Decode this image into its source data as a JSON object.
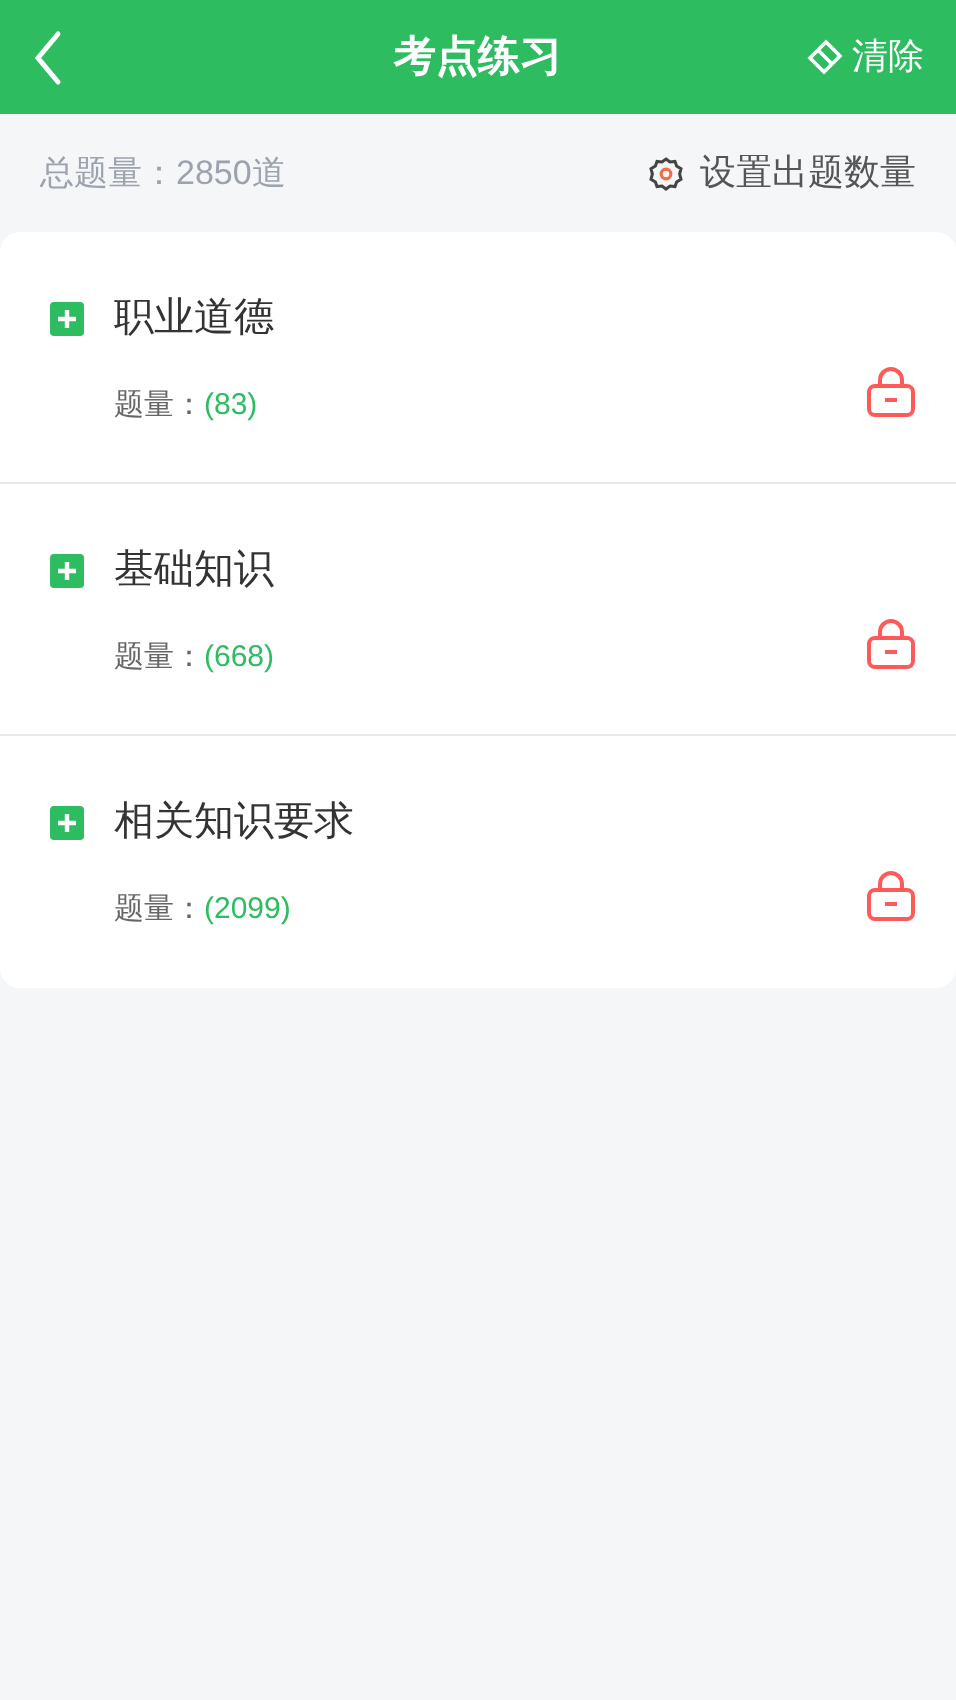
{
  "header": {
    "title": "考点练习",
    "clear_label": "清除"
  },
  "summary": {
    "total": "总题量：2850道",
    "settings_label": "设置出题数量"
  },
  "chapters": [
    {
      "title": "职业道德",
      "count_label": "题量：",
      "count": "(83)",
      "expanded": false,
      "locked": true
    },
    {
      "title": "基础知识",
      "count_label": "题量：",
      "count": "(668)",
      "expanded": false,
      "locked": true
    },
    {
      "title": "相关知识要求",
      "count_label": "题量：",
      "count": "(2099)",
      "expanded": false,
      "locked": true
    }
  ]
}
